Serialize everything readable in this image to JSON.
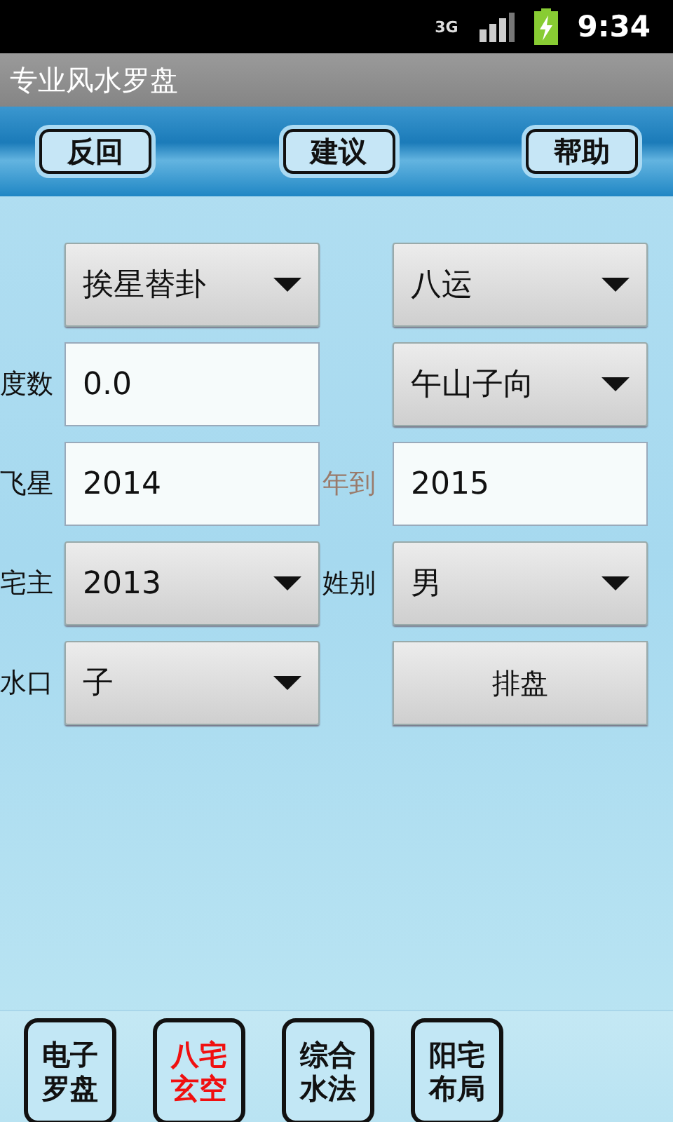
{
  "status_bar": {
    "network": "3G",
    "time": "9:34"
  },
  "title": "专业风水罗盘",
  "toolbar": [
    {
      "label": "反回"
    },
    {
      "label": "建议"
    },
    {
      "label": "帮助"
    }
  ],
  "form": [
    {
      "left": {
        "kind": "spinner",
        "value": "挨星替卦"
      },
      "right": {
        "kind": "spinner",
        "value": "八运"
      }
    },
    {
      "label": "度数",
      "left": {
        "kind": "input",
        "value": "0.0"
      },
      "right": {
        "kind": "spinner",
        "value": "午山子向"
      }
    },
    {
      "label": "飞星",
      "left": {
        "kind": "input",
        "value": "2014"
      },
      "middle": {
        "text": "年到",
        "disabled": true
      },
      "right": {
        "kind": "input",
        "value": "2015"
      }
    },
    {
      "label": "宅主",
      "left": {
        "kind": "spinner",
        "value": "2013"
      },
      "middle": {
        "text": "姓别",
        "disabled": false
      },
      "right": {
        "kind": "spinner",
        "value": "男"
      }
    },
    {
      "label": "水口",
      "left": {
        "kind": "spinner",
        "value": "子"
      },
      "right": {
        "kind": "button",
        "value": "排盘"
      }
    }
  ],
  "bottom_tabs": [
    {
      "lines": [
        "电子",
        "罗盘"
      ],
      "selected": false
    },
    {
      "lines": [
        "八宅",
        "玄空"
      ],
      "selected": true
    },
    {
      "lines": [
        "综合",
        "水法"
      ],
      "selected": false
    },
    {
      "lines": [
        "阳宅",
        "布局"
      ],
      "selected": false
    }
  ]
}
